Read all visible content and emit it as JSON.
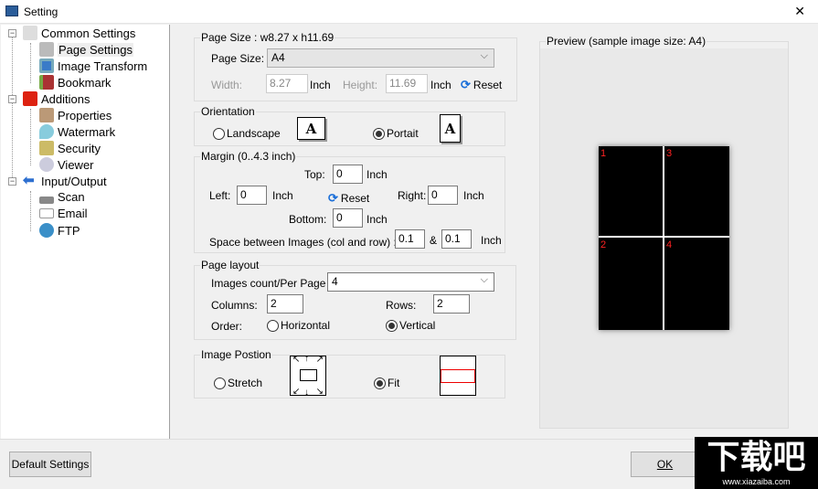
{
  "window": {
    "title": "Setting",
    "close": "✕"
  },
  "tree": {
    "items": [
      {
        "label": "Common Settings",
        "toggle": "−"
      },
      {
        "label": "Page Settings"
      },
      {
        "label": "Image Transform"
      },
      {
        "label": "Bookmark"
      },
      {
        "label": "Additions",
        "toggle": "−"
      },
      {
        "label": "Properties"
      },
      {
        "label": "Watermark"
      },
      {
        "label": "Security"
      },
      {
        "label": "Viewer"
      },
      {
        "label": "Input/Output",
        "toggle": "−"
      },
      {
        "label": "Scan"
      },
      {
        "label": "Email"
      },
      {
        "label": "FTP"
      }
    ]
  },
  "page_size": {
    "legend": "Page Size : w8.27 x h11.69",
    "label": "Page Size:",
    "value": "A4",
    "chevron": "⌵",
    "width_label": "Width:",
    "width": "8.27",
    "height_label": "Height:",
    "height": "11.69",
    "unit": "Inch",
    "reset": "Reset"
  },
  "orientation": {
    "legend": "Orientation",
    "landscape": "Landscape",
    "portrait": "Portait",
    "glyph": "A",
    "selected": "portrait"
  },
  "margin": {
    "legend": "Margin (0..4.3 inch)",
    "top_label": "Top:",
    "top": "0",
    "left_label": "Left:",
    "left": "0",
    "right_label": "Right:",
    "right": "0",
    "bottom_label": "Bottom:",
    "bottom": "0",
    "unit": "Inch",
    "reset": "Reset",
    "space_label": "Space between Images (col and row) :",
    "space_col": "0.1",
    "amp": "&",
    "space_row": "0.1"
  },
  "layout": {
    "legend": "Page layout",
    "count_label": "Images count/Per Page",
    "count": "4",
    "columns_label": "Columns:",
    "columns": "2",
    "rows_label": "Rows:",
    "rows": "2",
    "order_label": "Order:",
    "horizontal": "Horizontal",
    "vertical": "Vertical",
    "selected": "vertical"
  },
  "position": {
    "legend": "Image Postion",
    "stretch": "Stretch",
    "fit": "Fit",
    "selected": "fit"
  },
  "preview": {
    "legend": "Preview (sample image size: A4)",
    "cells": [
      "1",
      "3",
      "2",
      "4"
    ]
  },
  "footer": {
    "default": "Default Settings",
    "ok": "OK"
  },
  "watermark": {
    "text": "下载吧",
    "sub": "www.xiazaiba.com"
  }
}
